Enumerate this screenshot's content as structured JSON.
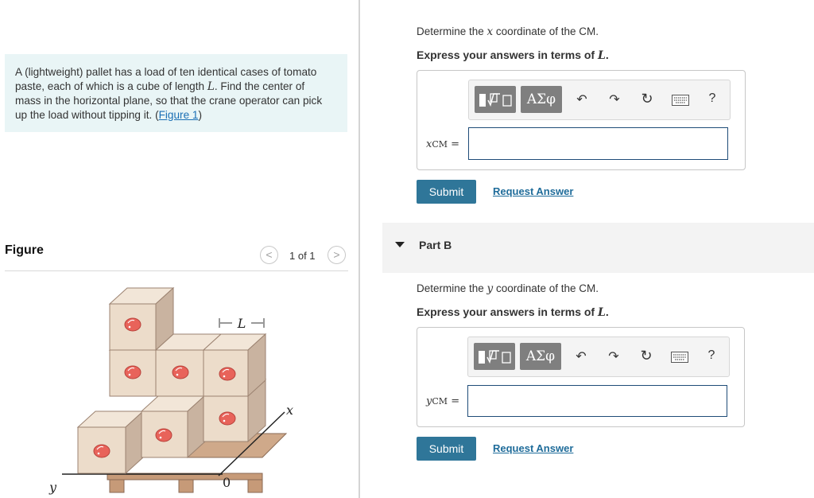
{
  "problem": {
    "line1": "A (lightweight) pallet has a load of ten identical cases of tomato",
    "line2a": "paste, each of which is a cube of length ",
    "var_L": "L",
    "line2b": ". Find the center of",
    "line3": "mass in the horizontal plane, so that the crane operator can pick",
    "line4": "up the load without tipping it. (",
    "figure_link": "Figure 1",
    "line4_end": ")"
  },
  "figure": {
    "title": "Figure",
    "pager_text": "1 of 1",
    "prev_symbol": "<",
    "next_symbol": ">",
    "labels": {
      "L": "L",
      "x": "x",
      "y": "y",
      "origin": "0"
    }
  },
  "part_a": {
    "prompt_pre": "Determine the ",
    "prompt_var": "x",
    "prompt_post": " coordinate of the CM.",
    "instruction_pre": "Express your answers in terms of ",
    "instruction_var": "L",
    "instruction_post": ".",
    "var_label": "x",
    "var_sub": "CM",
    "equals": "=",
    "input_value": "",
    "submit_label": "Submit",
    "request_label": "Request Answer"
  },
  "part_b": {
    "header": "Part B",
    "prompt_pre": "Determine the ",
    "prompt_var": "y",
    "prompt_post": " coordinate of the CM.",
    "instruction_pre": "Express your answers in terms of ",
    "instruction_var": "L",
    "instruction_post": ".",
    "var_label": "y",
    "var_sub": "CM",
    "equals": "=",
    "input_value": "",
    "submit_label": "Submit",
    "request_label": "Request Answer"
  },
  "toolbar": {
    "templates_icon": "fraction-sqrt-template-icon",
    "symbols_label": "ΑΣφ",
    "undo_icon": "undo-icon",
    "redo_icon": "redo-icon",
    "reset_icon": "reset-icon",
    "keyboard_icon": "keyboard-icon",
    "help_label": "?"
  },
  "colors": {
    "problem_bg": "#e9f5f6",
    "submit_bg": "#2f7699",
    "link": "#1f6c9a",
    "input_border": "#1f4c78",
    "box_face": "#ecdcca",
    "tomato": "#e8635a"
  }
}
